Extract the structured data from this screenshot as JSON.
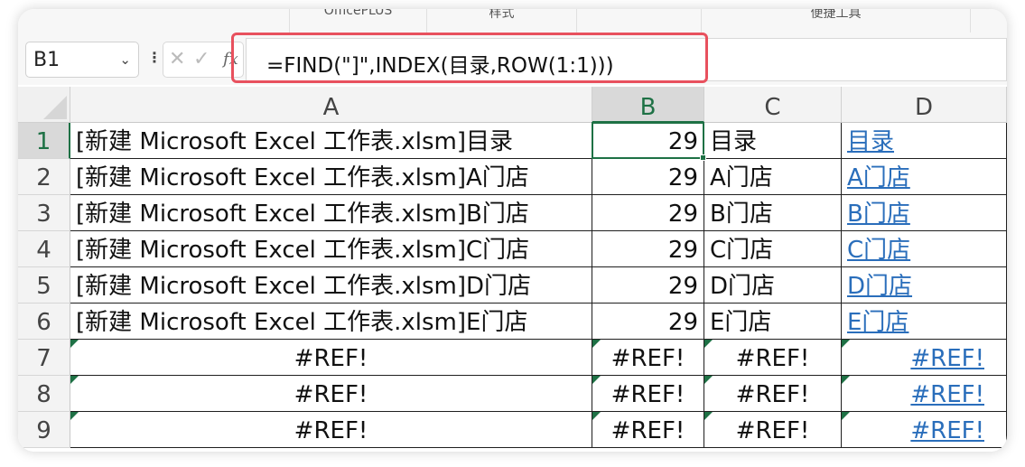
{
  "ribbon": {
    "groups": [
      {
        "label": "OfficePLUS"
      },
      {
        "label": "样式"
      },
      {
        "label": "便捷工具"
      }
    ]
  },
  "formula_bar": {
    "name_box": "B1",
    "formula": "=FIND(\"]\",INDEX(目录,ROW(1:1)))",
    "icons": [
      "chevron-down-icon",
      "more-dots-icon",
      "cancel-icon",
      "confirm-icon",
      "function-icon"
    ]
  },
  "grid": {
    "columns": [
      "A",
      "B",
      "C",
      "D"
    ],
    "selected_column": "B",
    "selected_row": "1",
    "rows": [
      {
        "num": "1",
        "a": "[新建 Microsoft Excel 工作表.xlsm]目录",
        "b": "29",
        "c": "目录",
        "d": "目录",
        "error": false
      },
      {
        "num": "2",
        "a": "[新建 Microsoft Excel 工作表.xlsm]A门店",
        "b": "29",
        "c": "A门店",
        "d": "A门店",
        "error": false
      },
      {
        "num": "3",
        "a": "[新建 Microsoft Excel 工作表.xlsm]B门店",
        "b": "29",
        "c": "B门店",
        "d": "B门店",
        "error": false
      },
      {
        "num": "4",
        "a": "[新建 Microsoft Excel 工作表.xlsm]C门店",
        "b": "29",
        "c": "C门店",
        "d": "C门店",
        "error": false
      },
      {
        "num": "5",
        "a": "[新建 Microsoft Excel 工作表.xlsm]D门店",
        "b": "29",
        "c": "D门店",
        "d": "D门店",
        "error": false
      },
      {
        "num": "6",
        "a": "[新建 Microsoft Excel 工作表.xlsm]E门店",
        "b": "29",
        "c": "E门店",
        "d": "E门店",
        "error": false
      },
      {
        "num": "7",
        "a": "#REF!",
        "b": "#REF!",
        "c": "#REF!",
        "d": "#REF!",
        "error": true
      },
      {
        "num": "8",
        "a": "#REF!",
        "b": "#REF!",
        "c": "#REF!",
        "d": "#REF!",
        "error": true
      },
      {
        "num": "9",
        "a": "#REF!",
        "b": "#REF!",
        "c": "#REF!",
        "d": "#REF!",
        "error": true
      }
    ]
  },
  "colors": {
    "accent_green": "#1e7145",
    "highlight_red": "#e8515e",
    "link_blue": "#2a6ebb"
  }
}
